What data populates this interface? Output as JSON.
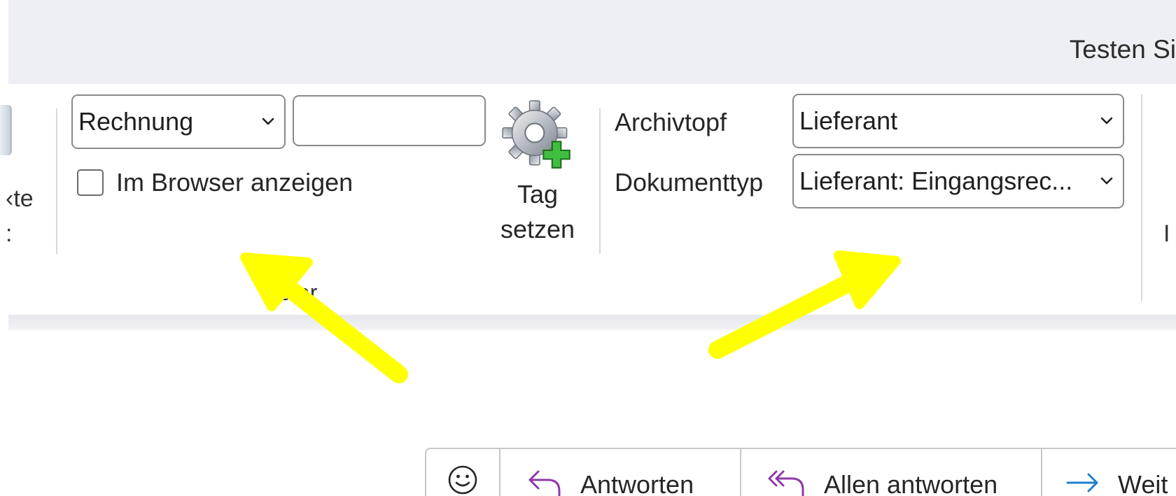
{
  "window": {
    "title_fragment": "Testen Si"
  },
  "ribbon": {
    "left_clip_text_1": "‹te",
    "left_clip_text_2": ":",
    "group1": {
      "combo_value": "Rechnung",
      "text_input_value": "",
      "checkbox_label": "Im Browser anzeigen",
      "checkbox_checked": false,
      "group_label_fragment": "ular"
    },
    "tag_button": {
      "label_line1": "Tag",
      "label_line2": "setzen",
      "icon": "gear-add-icon"
    },
    "group2": {
      "archiv_label": "Archivtopf",
      "archiv_value": "Lieferant",
      "doktyp_label": "Dokumenttyp",
      "doktyp_value": "Lieferant: Eingangsrec..."
    },
    "right_clip_text": "I"
  },
  "annotations": {
    "arrow_color": "#ffff00"
  },
  "message_toolbar": {
    "emoji_icon": "smiley-icon",
    "reply_label": "Antworten",
    "reply_all_label": "Allen antworten",
    "forward_label": "Weit",
    "reply_color": "#8e3aa7",
    "forward_color": "#1e7fd0"
  }
}
